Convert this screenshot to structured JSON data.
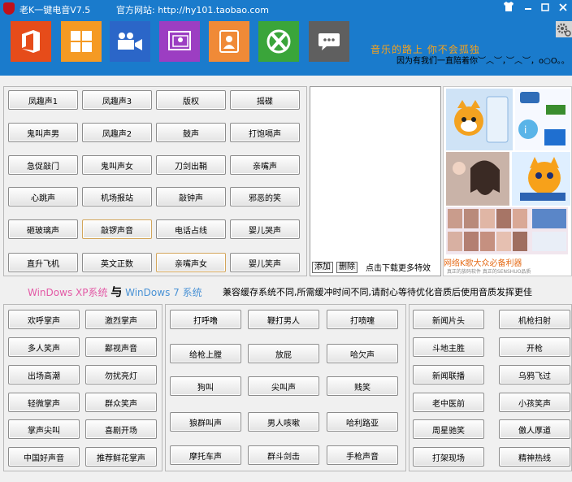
{
  "window": {
    "title": "老K一键电音V7.5",
    "site": "官方网站: http://hy101.taobao.com",
    "controls": [
      "shirt-icon",
      "minimize-icon",
      "maximize-icon",
      "close-icon"
    ]
  },
  "tiles": [
    {
      "name": "office-tile",
      "icon": "office-icon",
      "color": "#e64c1a"
    },
    {
      "name": "windows-tile",
      "icon": "windows-icon",
      "color": "#f59a23"
    },
    {
      "name": "video-tile",
      "icon": "video-camera-icon",
      "color": "#2b66c8"
    },
    {
      "name": "contacts-tile",
      "icon": "contact-card-icon",
      "color": "#9c3ec2"
    },
    {
      "name": "person-tile",
      "icon": "person-icon",
      "color": "#f08a37"
    },
    {
      "name": "xbox-tile",
      "icon": "xbox-icon",
      "color": "#3aa53a"
    },
    {
      "name": "message-tile",
      "icon": "chat-bubble-icon",
      "color": "#5f5f5f"
    }
  ],
  "slogan": {
    "line1": "音乐的路上 你不会孤独",
    "line2": "因为有我们一直陪着你︶︿︶，︶︿︶，o○O。。"
  },
  "top_buttons": [
    [
      "凤趣声1",
      "凤趣声3",
      "版权",
      "摇碟"
    ],
    [
      "鬼叫声男",
      "凤趣声2",
      "鼓声",
      "打饱嗝声"
    ],
    [
      "急促敲门",
      "鬼叫声女",
      "刀剑出鞘",
      "亲嘴声"
    ],
    [
      "心跳声",
      "机场报站",
      "敲钟声",
      "邪恶的笑"
    ],
    [
      "砸玻璃声",
      "敲锣声音",
      "电话占线",
      "婴儿哭声"
    ],
    [
      "直升飞机",
      "英文正数",
      "亲嘴声女",
      "婴儿笑声"
    ]
  ],
  "log": {
    "add_label": "添加",
    "delete_label": "删除",
    "hint": "点击下载更多特效"
  },
  "ad": {
    "caption": "网络K歌大众必备利器",
    "sub": "真正的放码软件 真正的SENSHUO品质"
  },
  "system_note": {
    "xp": "WinDows XP系统",
    "amp": "与",
    "win7": "WinDows 7 系统",
    "notice": "兼容缓存系统不同,所需缓冲时间不同,请耐心等待优化音质后使用音质发挥更佳"
  },
  "bottom_left": [
    [
      "欢呼掌声",
      "激烈掌声"
    ],
    [
      "多人笑声",
      "鄙视声音"
    ],
    [
      "出场高潮",
      "勿扰亮灯"
    ],
    [
      "轻微掌声",
      "群众笑声"
    ],
    [
      "掌声尖叫",
      "喜剧开场"
    ],
    [
      "中国好声音",
      "推荐鲜花掌声"
    ]
  ],
  "bottom_mid": [
    [
      "打呼噜",
      "鞭打男人",
      "打喷嚏"
    ],
    [
      "给枪上膛",
      "放屁",
      "哈欠声"
    ],
    [
      "狗叫",
      "尖叫声",
      "贱笑"
    ],
    [
      "狼群叫声",
      "男人咳嗽",
      "哈利路亚"
    ],
    [
      "摩托车声",
      "群斗剑击",
      "手枪声音"
    ]
  ],
  "bottom_right": [
    [
      "新闻片头",
      "机枪扫射"
    ],
    [
      "斗地主胜",
      "开枪"
    ],
    [
      "新闻联播",
      "乌鸦飞过"
    ],
    [
      "老中医前",
      "小孩笑声"
    ],
    [
      "周星驰笑",
      "傲人厚道"
    ],
    [
      "打架现场",
      "精神热线"
    ]
  ]
}
